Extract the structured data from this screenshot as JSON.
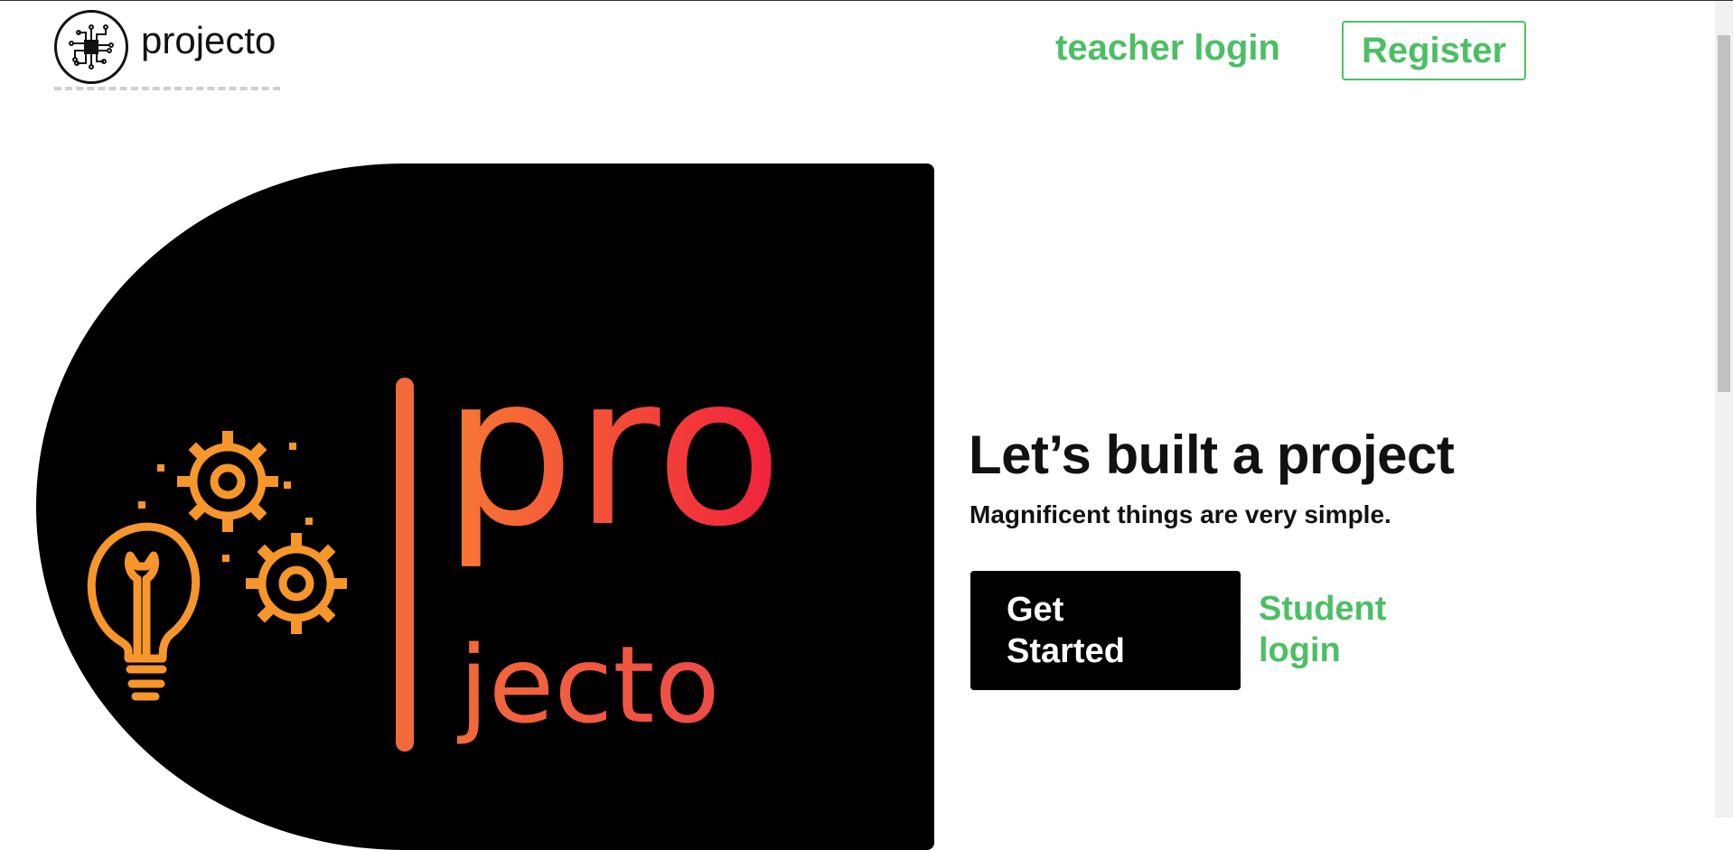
{
  "header": {
    "brand_name": "projecto",
    "teacher_login": "teacher login",
    "register": "Register"
  },
  "hero": {
    "logo_text_top": "pro",
    "logo_text_bottom": "jecto",
    "title": "Let’s built a project",
    "subtitle": "Magnificent things are very simple.",
    "get_started": "Get Started",
    "student_login": "Student login"
  },
  "colors": {
    "accent_green": "#4cbf64",
    "logo_orange": "#f7962a",
    "logo_red": "#f0203c"
  },
  "icons": [
    "circuit-chip-icon",
    "lightbulb-wrench-icon",
    "gear-icon"
  ]
}
